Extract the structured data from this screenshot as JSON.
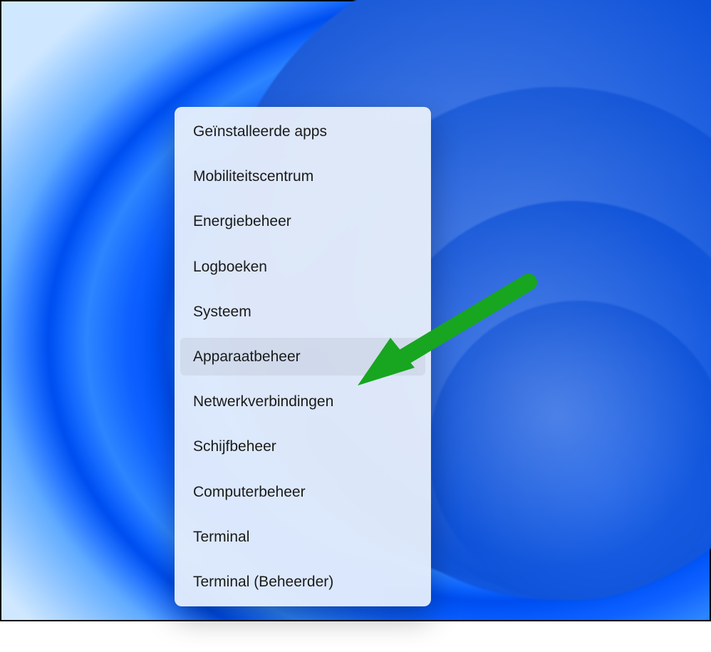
{
  "menu": {
    "items": [
      {
        "label": "Geïnstalleerde apps",
        "highlight": false
      },
      {
        "label": "Mobiliteitscentrum",
        "highlight": false
      },
      {
        "label": "Energiebeheer",
        "highlight": false
      },
      {
        "label": "Logboeken",
        "highlight": false
      },
      {
        "label": "Systeem",
        "highlight": false
      },
      {
        "label": "Apparaatbeheer",
        "highlight": true
      },
      {
        "label": "Netwerkverbindingen",
        "highlight": false
      },
      {
        "label": "Schijfbeheer",
        "highlight": false
      },
      {
        "label": "Computerbeheer",
        "highlight": false
      },
      {
        "label": "Terminal",
        "highlight": false
      },
      {
        "label": "Terminal (Beheerder)",
        "highlight": false
      }
    ]
  },
  "annotation": {
    "arrow_color": "#18a520"
  }
}
